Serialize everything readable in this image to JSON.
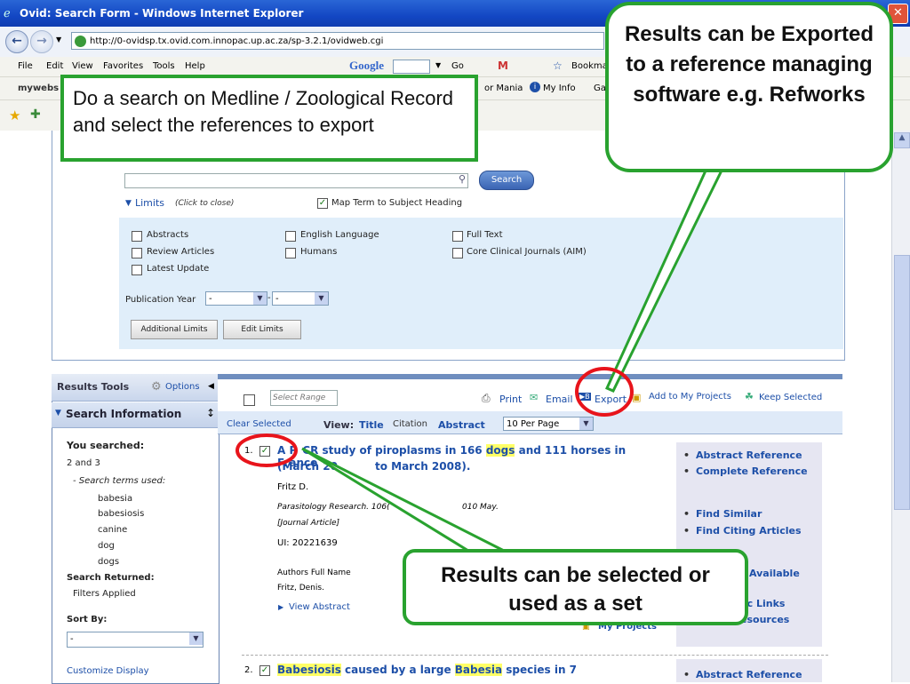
{
  "window": {
    "title": "Ovid: Search Form - Windows Internet Explorer"
  },
  "browser": {
    "address": "http://0-ovidsp.tx.ovid.com.innopac.up.ac.za/sp-3.2.1/ovidweb.cgi",
    "menu": [
      "File",
      "Edit",
      "View",
      "Favorites",
      "Tools",
      "Help"
    ],
    "google_label": "Google",
    "go_label": "Go",
    "bookmarks_label": "Bookmarks",
    "links_fragments": [
      "mywebs",
      "or Mania",
      "My Info",
      "Ga"
    ]
  },
  "search": {
    "button_label": "Search",
    "limits_toggle": "Limits",
    "limits_hint": "(Click to close)",
    "map_term_label": "Map Term to Subject Heading",
    "limits": {
      "col1": [
        "Abstracts",
        "Review Articles",
        "Latest Update"
      ],
      "col2": [
        "English Language",
        "Humans"
      ],
      "col3": [
        "Full Text",
        "Core Clinical Journals (AIM)"
      ]
    },
    "pub_year_label": "Publication Year",
    "pub_year_from": "-",
    "pub_year_to": "-",
    "additional_limits": "Additional Limits",
    "edit_limits": "Edit Limits"
  },
  "results_tools": {
    "title": "Results Tools",
    "options_label": "Options",
    "search_info_title": "Search Information",
    "you_searched_label": "You searched:",
    "you_searched_value": "2 and 3",
    "search_terms_label": "- Search terms used:",
    "search_terms": [
      "babesia",
      "babesiosis",
      "canine",
      "dog",
      "dogs"
    ],
    "search_returned_label": "Search Returned:",
    "filters_applied": "Filters Applied",
    "sort_by_label": "Sort By:",
    "sort_by_value": "-",
    "customize_display": "Customize Display"
  },
  "toolbar": {
    "select_range_placeholder": "Select Range",
    "print": "Print",
    "email": "Email",
    "export": "Export",
    "add_to_projects": "Add to My Projects",
    "keep_selected": "Keep Selected",
    "clear_selected": "Clear Selected",
    "view_label": "View:",
    "view_title": "Title",
    "view_citation": "Citation",
    "view_abstract": "Abstract",
    "per_page": "10 Per Page"
  },
  "results": [
    {
      "num": "1.",
      "title_a": "A P",
      "title_b": "CR study of piroplasms in 166 ",
      "title_hl": "dogs",
      "title_c": " and 111 horses in France",
      "title_line2": "(March 20",
      "title_line2b": "to March 2008).",
      "author": "Fritz D.",
      "source": "Parasitology Research. 106(",
      "source_b": "010 May.",
      "pub_type": "[Journal Article]",
      "ui": "UI: 20221639",
      "authors_full_label": "Authors Full Name",
      "authors_full": "Fritz, Denis.",
      "view_abstract": "View Abstract",
      "my_projects_fragment": "My Projects",
      "links": [
        "Abstract Reference",
        "Complete Reference",
        "Find Similar",
        "Find Citing Articles",
        "Available",
        "hic Links",
        "esources"
      ]
    },
    {
      "num": "2.",
      "title_hl1": "Babesiosis",
      "title_a": " caused by a large ",
      "title_hl2": "Babesia",
      "title_b": " species in 7",
      "links": [
        "Abstract Reference"
      ]
    }
  ],
  "callouts": {
    "top_left": "Do a search on Medline / Zoological Record and select the references to export",
    "top_right": "Results can be Exported to a reference managing software e.g. Refworks",
    "bottom": "Results can be selected or used as a set"
  },
  "colors": {
    "callout_border": "#29a22f",
    "annotation_red": "#e8141b",
    "highlight": "#ffff66"
  }
}
